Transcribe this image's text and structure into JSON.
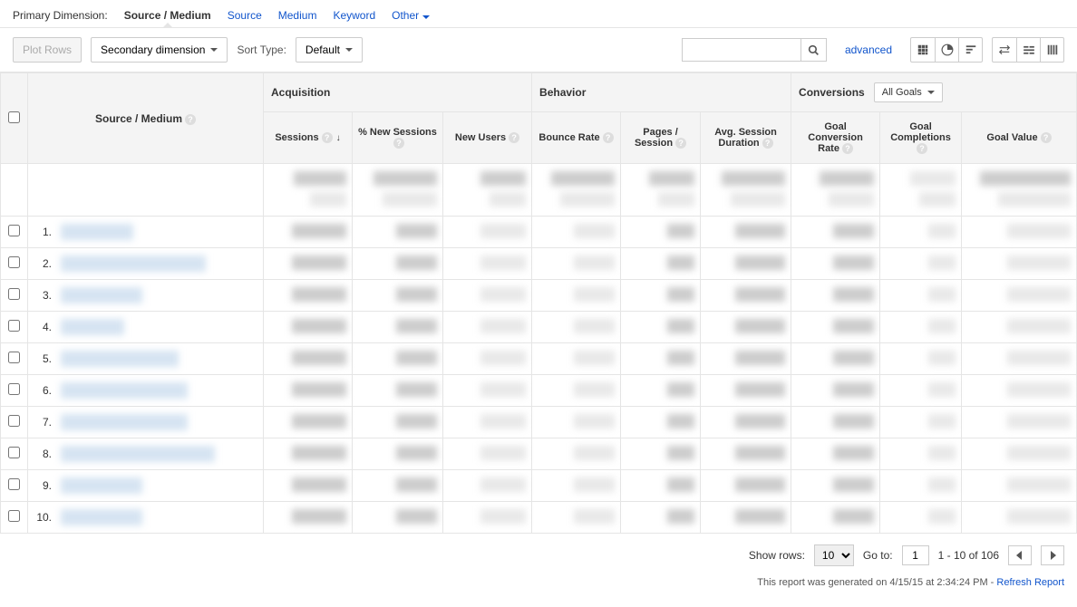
{
  "primaryDimension": {
    "label": "Primary Dimension:",
    "active": "Source / Medium",
    "options": [
      "Source",
      "Medium",
      "Keyword",
      "Other"
    ]
  },
  "toolbar": {
    "plotRows": "Plot Rows",
    "secondaryDim": "Secondary dimension",
    "sortTypeLabel": "Sort Type:",
    "sortTypeValue": "Default",
    "advanced": "advanced"
  },
  "columns": {
    "dimHeader": "Source / Medium",
    "groups": {
      "acquisition": "Acquisition",
      "behavior": "Behavior",
      "conversions": "Conversions",
      "goalSelect": "All Goals"
    },
    "metrics": {
      "sessions": "Sessions",
      "newSessions": "% New Sessions",
      "newUsers": "New Users",
      "bounce": "Bounce Rate",
      "pages": "Pages / Session",
      "duration": "Avg. Session Duration",
      "convRate": "Goal Conversion Rate",
      "completions": "Goal Completions",
      "value": "Goal Value"
    }
  },
  "rows": [
    {
      "num": "1."
    },
    {
      "num": "2."
    },
    {
      "num": "3."
    },
    {
      "num": "4."
    },
    {
      "num": "5."
    },
    {
      "num": "6."
    },
    {
      "num": "7."
    },
    {
      "num": "8."
    },
    {
      "num": "9."
    },
    {
      "num": "10."
    }
  ],
  "pager": {
    "showRowsLabel": "Show rows:",
    "showRowsValue": "10",
    "gotoLabel": "Go to:",
    "gotoValue": "1",
    "range": "1 - 10 of 106"
  },
  "footer": {
    "text": "This report was generated on 4/15/15 at 2:34:24 PM - ",
    "refresh": "Refresh Report"
  }
}
